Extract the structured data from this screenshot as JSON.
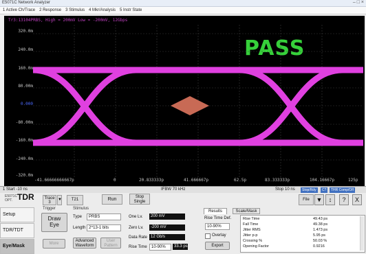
{
  "window": {
    "title": "E5071C Network Analyzer",
    "controls": "– □ ×"
  },
  "menu": [
    "1 Active Ch/Trace",
    "2 Response",
    "3 Stimulus",
    "4 Mkr/Analysis",
    "5 Instr State"
  ],
  "screen": {
    "info": "Tr3:13104PRBS, High = 200mV Low = -200mV, 12Gbps",
    "verdict": "PASS",
    "verdict_color": "#36d03a",
    "eye_color": "#e040e0",
    "mask_color": "#c86a55",
    "y_ticks": [
      "320.0m",
      "240.0m",
      "160.0m",
      "80.00m",
      "0.000",
      "-80.00m",
      "-160.0m",
      "-240.0m",
      "-320.0m"
    ],
    "x_ticks": [
      "-41.66666666667p",
      "0",
      "20.833333p",
      "41.666667p",
      "62.5p",
      "83.333333p",
      "104.16667p",
      "125p"
    ]
  },
  "status": {
    "start": "1 Start -10 ns",
    "ifbw": "IFBW 70 kHz",
    "stop": "Stop 10 ns",
    "btn1": "Stop/Rdy",
    "btn2": "C?",
    "btn3": "THR Comp/Off"
  },
  "tdr": {
    "logo_small1": "E5071C",
    "logo_small2": "OPT.",
    "logo_big": "TDR",
    "trace_label": "Trace",
    "trace_num": "3",
    "t21_label": "T21",
    "run_label": "Run",
    "stop_single_1": "Stop",
    "stop_single_2": "Single",
    "file_label": "File",
    "help_label": "?",
    "close_label": "X",
    "tabs": [
      "Setup",
      "TDR/TDT",
      "Eye/Mask"
    ],
    "trigger_label": "Trigger",
    "draw_eye_1": "Draw",
    "draw_eye_2": "Eye",
    "more_label": "More",
    "stimulus_label": "Stimulus",
    "type_label": "Type",
    "type_value": "PRBS",
    "length_label": "Length",
    "length_value": "2^13-1 bits",
    "adv_1": "Advanced",
    "adv_2": "Waveform",
    "user_1": "User",
    "user_2": "Pattern",
    "one_lv_label": "One Lv.",
    "one_lv_value": "200 mV",
    "zero_lv_label": "Zero Lv.",
    "zero_lv_value": "-200 mV",
    "data_rate_label": "Data Rate",
    "data_rate_value": "12 Gb/s",
    "rise_time_label": "Rise Time",
    "rise_time_sel": "10-90%",
    "rise_time_value": "33.3 ps",
    "results_tab": "Results",
    "scale_mask_tab": "Scale/Mask",
    "rise_def_label": "Rise Time Def.",
    "rise_def_value": "10-90%",
    "overlay_label": "Overlay",
    "export_label": "Export",
    "results": [
      {
        "name": "Rise Time",
        "value": "49.43 ps"
      },
      {
        "name": "Fall Time",
        "value": "49.38 ps"
      },
      {
        "name": "Jitter RMS",
        "value": "1.473 ps"
      },
      {
        "name": "Jitter p-p",
        "value": "5.95 ps"
      },
      {
        "name": "Crossing %",
        "value": "50.03 %"
      },
      {
        "name": "Opening Factor",
        "value": "0.9216"
      }
    ]
  }
}
